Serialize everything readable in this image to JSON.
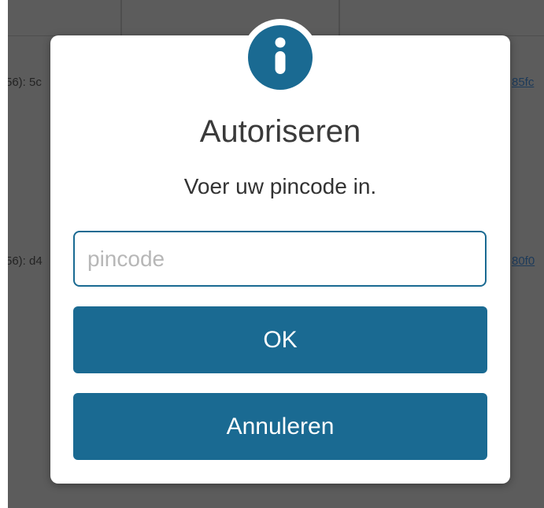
{
  "background": {
    "row1_left_text": "56): 5c",
    "row1_right_text": "85fc",
    "row2_left_text": "56): d4",
    "row2_right_text": "80f0"
  },
  "dialog": {
    "icon": "info-icon",
    "title": "Autoriseren",
    "message": "Voer uw pincode in.",
    "pin_field": {
      "value": "",
      "placeholder": "pincode"
    },
    "ok_label": "OK",
    "cancel_label": "Annuleren"
  },
  "colors": {
    "accent": "#1a6a92",
    "overlay": "#5c5c5c",
    "dialog_bg": "#ffffff",
    "placeholder": "#b7b7b7"
  }
}
